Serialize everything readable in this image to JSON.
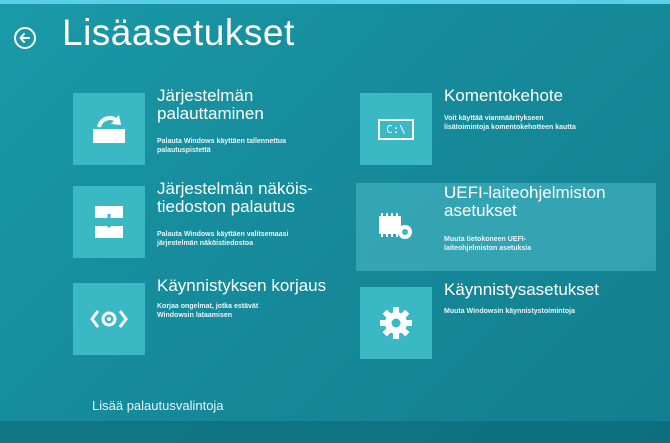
{
  "header": {
    "title": "Lisäasetukset"
  },
  "tiles": [
    {
      "title_line1": "Järjestelmän",
      "title_line2": "palauttaminen",
      "desc_line1": "Palauta Windows käyttäen tallennettua",
      "desc_line2": "palautuspistettä",
      "icon": "system-restore-icon"
    },
    {
      "title_line1": "Järjestelmän näköis-",
      "title_line2": "tiedoston palautus",
      "desc_line1": "Palauta Windows käyttäen valitsemaasi",
      "desc_line2": "järjestelmän näköistiedostoa",
      "icon": "system-image-icon"
    },
    {
      "title_line1": "Käynnistyksen korjaus",
      "desc_line1": "Korjaa ongelmat, jotka estävät",
      "desc_line2": "Windowsin lataamisen",
      "icon": "startup-repair-icon"
    },
    {
      "title_line1": "Komentokehote",
      "desc_line1": "Voit käyttää vianmääritykseen",
      "desc_line2": "lisätoimintoja komentokehotteen kautta",
      "icon": "command-prompt-icon",
      "icon_text": "C:\\"
    },
    {
      "title_line1": "UEFI-laiteohjelmiston",
      "title_line2": "asetukset",
      "desc_line1": "Muuta tietokoneen UEFI-",
      "desc_line2": "laiteohjelmiston asetuksia",
      "icon": "uefi-chip-gear-icon"
    },
    {
      "title_line1": "Käynnistysasetukset",
      "desc_line1": "Muuta Windowsin käynnistystoimintoja",
      "icon": "gear-icon"
    }
  ],
  "footer": {
    "more_options": "Lisää palautusvalintoja"
  },
  "colors": {
    "background": "#168c9c",
    "tile": "#3ab9c4",
    "highlight": "#5ac8d4"
  }
}
